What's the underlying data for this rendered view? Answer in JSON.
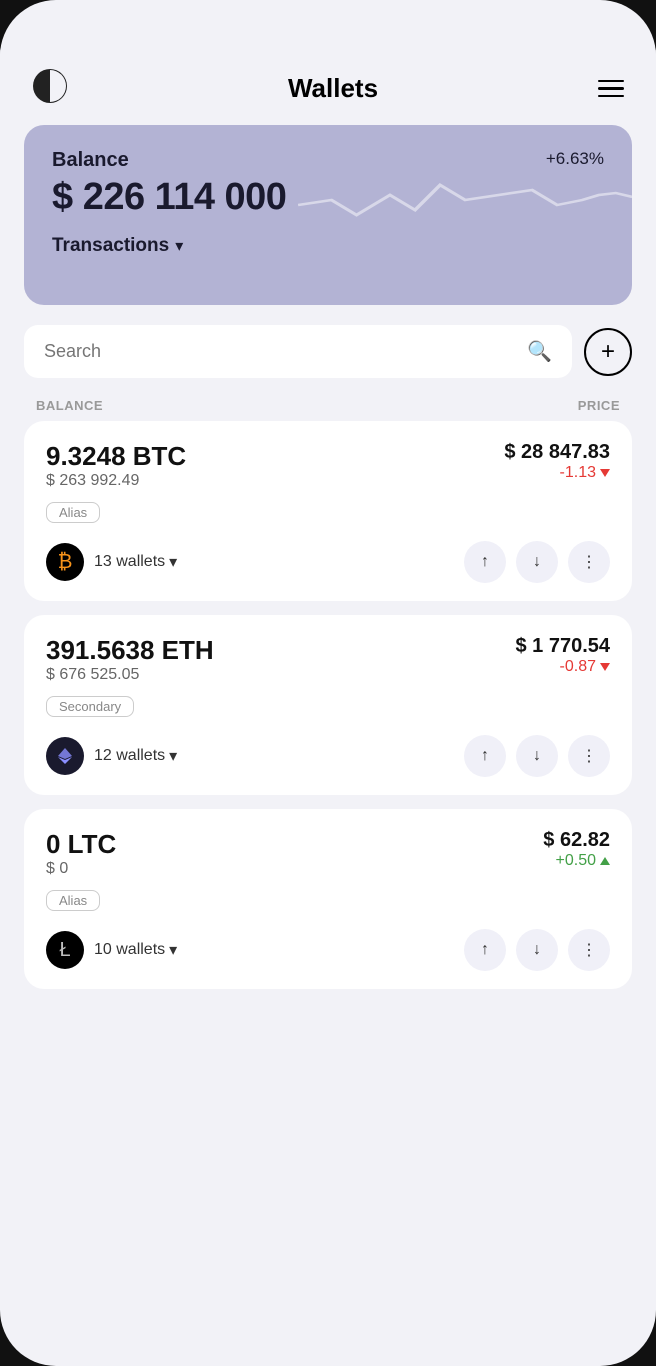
{
  "header": {
    "title": "Wallets",
    "logo": "half-circle-logo",
    "menu": "menu-icon"
  },
  "balance_card": {
    "label": "Balance",
    "percent": "+6.63%",
    "amount": "$ 226 114 000",
    "transactions_label": "Transactions"
  },
  "search": {
    "placeholder": "Search",
    "add_button_label": "+"
  },
  "columns": {
    "balance_label": "BALANCE",
    "price_label": "PRICE"
  },
  "crypto_list": [
    {
      "id": "btc",
      "balance_amount": "9.3248 BTC",
      "balance_usd": "$ 263 992.49",
      "alias": "Alias",
      "price": "$ 28 847.83",
      "change": "-1.13",
      "change_type": "negative",
      "wallets_count": "13 wallets",
      "icon_symbol": "₿",
      "icon_class": "coin-icon-btc"
    },
    {
      "id": "eth",
      "balance_amount": "391.5638 ETH",
      "balance_usd": "$ 676 525.05",
      "alias": "Secondary",
      "price": "$ 1 770.54",
      "change": "-0.87",
      "change_type": "negative",
      "wallets_count": "12 wallets",
      "icon_symbol": "⬟",
      "icon_class": "coin-icon-eth"
    },
    {
      "id": "ltc",
      "balance_amount": "0 LTC",
      "balance_usd": "$ 0",
      "alias": "Alias",
      "price": "$ 62.82",
      "change": "+0.50",
      "change_type": "positive",
      "wallets_count": "10 wallets",
      "icon_symbol": "Ł",
      "icon_class": "coin-icon-ltc"
    }
  ]
}
